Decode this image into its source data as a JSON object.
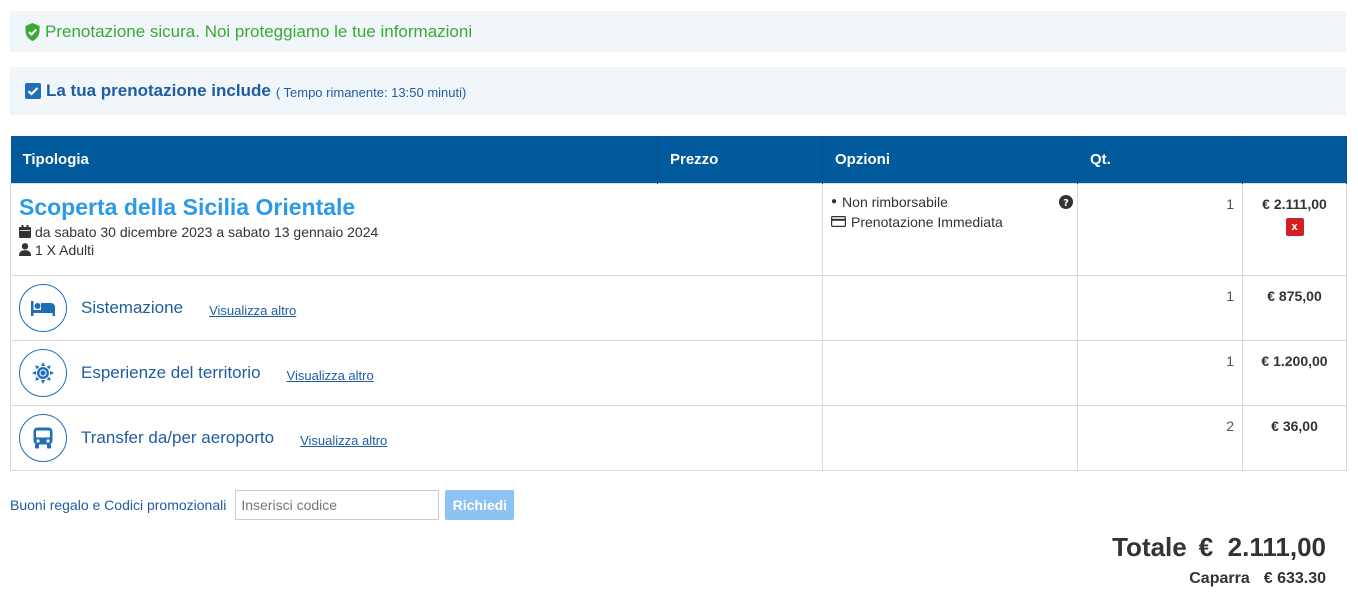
{
  "secure_banner": {
    "text": "Prenotazione sicura. Noi proteggiamo le tue informazioni"
  },
  "includes": {
    "title": "La tua prenotazione include",
    "timer": "( Tempo rimanente: 13:50 minuti)"
  },
  "table": {
    "headers": {
      "type": "Tipologia",
      "price": "Prezzo",
      "options": "Opzioni",
      "qty": "Qt."
    },
    "tour": {
      "title": "Scoperta della Sicilia Orientale",
      "dates": "da sabato 30 dicembre 2023 a sabato 13 gennaio 2024",
      "guests": "1 X Adulti",
      "option_1": "Non rimborsabile",
      "option_2": "Prenotazione Immediata",
      "qty": "1",
      "price": "€ 2.111,00",
      "remove": "x"
    },
    "services": [
      {
        "label": "Sistemazione",
        "link": "Visualizza altro",
        "qty": "1",
        "price": "€ 875,00"
      },
      {
        "label": "Esperienze del territorio",
        "link": "Visualizza altro",
        "qty": "1",
        "price": "€ 1.200,00"
      },
      {
        "label": "Transfer da/per aeroporto",
        "link": "Visualizza altro",
        "qty": "2",
        "price": "€ 36,00"
      }
    ]
  },
  "promo": {
    "label": "Buoni regalo e Codici promozionali",
    "placeholder": "Inserisci codice",
    "button": "Richiedi"
  },
  "totals": {
    "total_label": "Totale",
    "total_value": "€  2.111,00",
    "deposit_label": "Caparra",
    "deposit_value": "€ 633.30"
  }
}
